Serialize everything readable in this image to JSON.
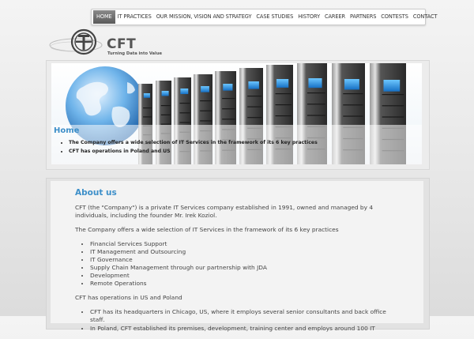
{
  "nav": {
    "items": [
      "HOME",
      "IT PRACTICES",
      "OUR MISSION, VISION AND STRATEGY",
      "CASE STUDIES",
      "HISTORY",
      "CAREER",
      "PARTNERS",
      "CONTESTS",
      "CONTACT"
    ],
    "active": "HOME"
  },
  "logo": {
    "name": "CFT",
    "tagline": "Turning Data into Value"
  },
  "banner": {
    "title": "Home",
    "bullets": [
      "The Company offers a wide selection of IT Services in the framework of its 6 key practices",
      "CFT has operations in Poland and US"
    ]
  },
  "content": {
    "heading": "About us",
    "intro": "CFT (the \"Company\") is a private IT Services company established in 1991, owned and managed by 4 individuals, including the founder Mr. Irek Koziol.",
    "practices_intro": "The Company offers a wide selection of IT Services in the framework of its 6 key practices",
    "practices": [
      "Financial Services Support",
      "IT Management and Outsourcing",
      "IT Governance",
      "Supply Chain Management through our partnership with JDA",
      "Development",
      "Remote Operations"
    ],
    "operations_intro": "CFT has operations in US and Poland",
    "operations": [
      "CFT has its headquarters in Chicago, US, where it employs several senior consultants and back office staff.",
      "In Poland, CFT established its premises, development, training center and employs around 100 IT"
    ]
  },
  "colors": {
    "accent": "#3d8fc9",
    "nav_active": "#6a6a6a"
  }
}
